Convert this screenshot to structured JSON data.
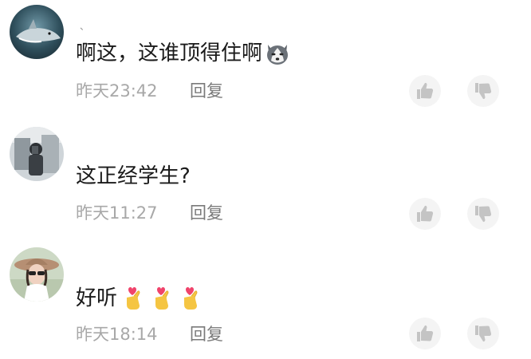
{
  "comments": [
    {
      "username": "、",
      "text": "啊这，这谁顶得住啊",
      "emoji": "husky-emoji",
      "time": "昨天23:42",
      "reply_label": "回复",
      "avatar": "shark-avatar"
    },
    {
      "username": "",
      "text": "这正经学生?",
      "emoji": "",
      "time": "昨天11:27",
      "reply_label": "回复",
      "avatar": "mirror-selfie-avatar"
    },
    {
      "username": "",
      "text": "好听",
      "emoji": "finger-heart-emoji",
      "time": "昨天18:14",
      "reply_label": "回复",
      "avatar": "woman-hat-avatar"
    }
  ],
  "colors": {
    "text": "#1a1a1a",
    "meta": "#a8a8a8",
    "reply": "#7a7a7a",
    "icon": "#c4c4c4",
    "button_bg": "#f4f4f4"
  },
  "icons": [
    "thumbs-up-icon",
    "thumbs-down-icon"
  ]
}
